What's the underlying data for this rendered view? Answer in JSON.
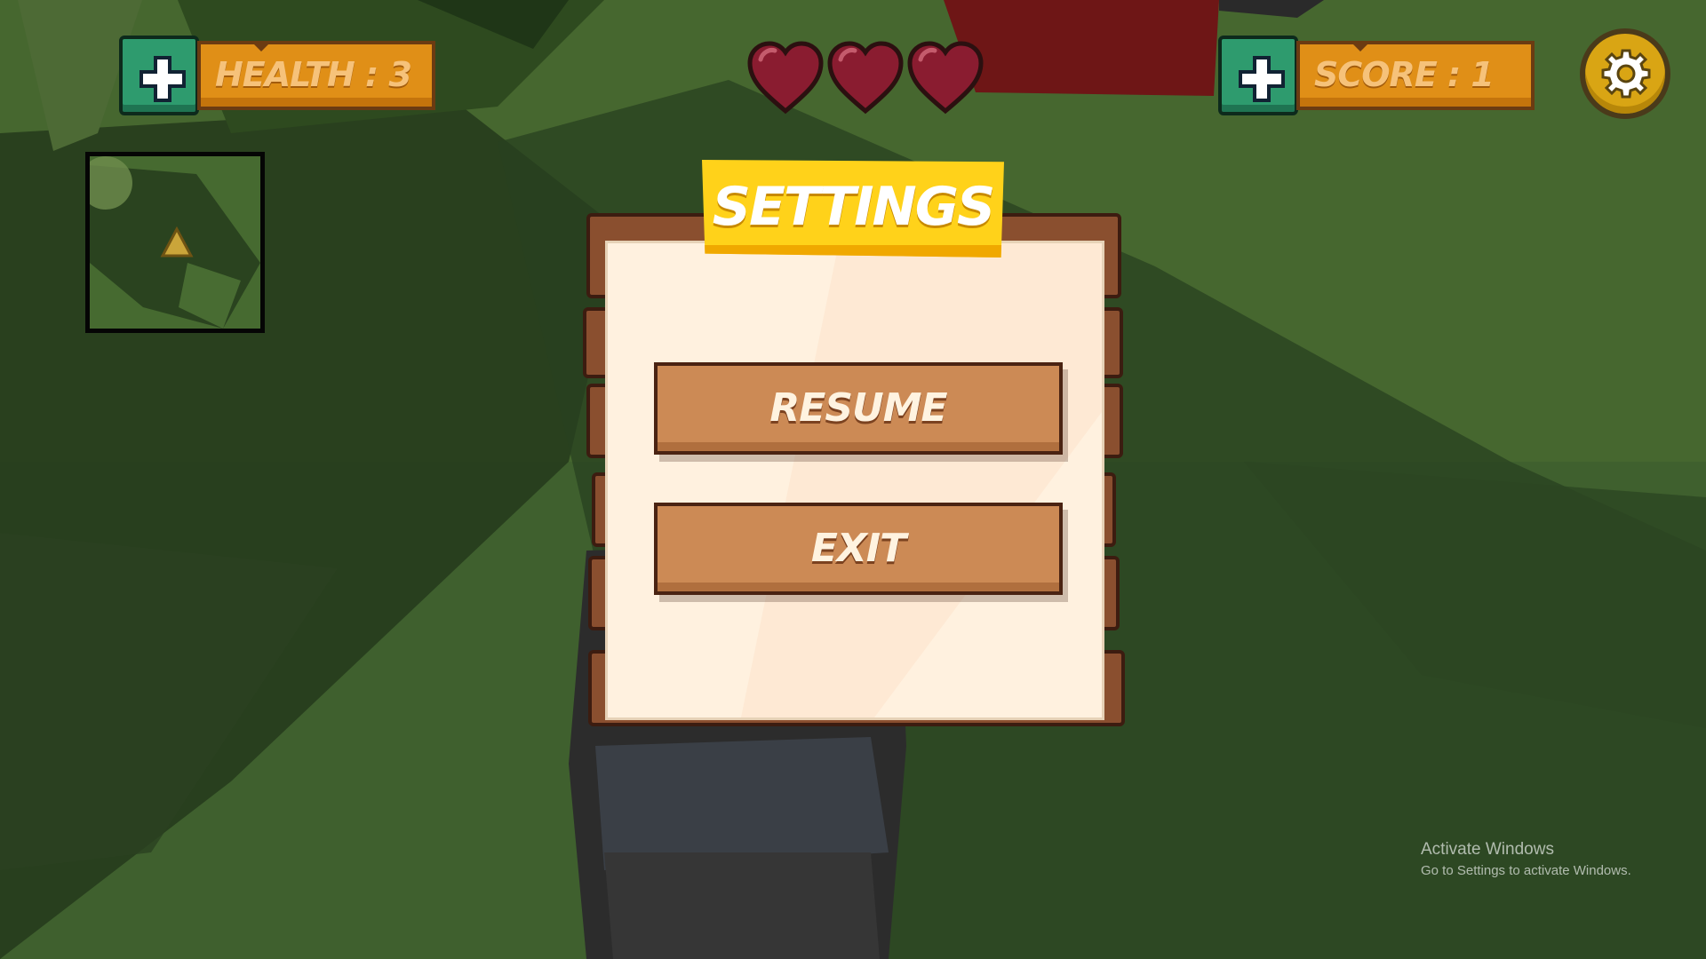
{
  "hud": {
    "health_label": "HEALTH : 3",
    "score_label": "SCORE : 1",
    "hearts": 3
  },
  "dialog": {
    "title": "SETTINGS",
    "buttons": {
      "resume": "RESUME",
      "exit": "EXIT"
    }
  },
  "watermark": {
    "title": "Activate Windows",
    "subtitle": "Go to Settings to activate Windows."
  },
  "colors": {
    "grass": "#3a5a2c",
    "hud_orange": "#e08f17",
    "hud_green": "#2e9b6e",
    "heart": "#8a1c30",
    "title_yellow": "#ffd21a",
    "plank": "#8a4f2f",
    "button_wood": "#cc8a55",
    "paper": "#fff1df"
  },
  "icons": [
    "plus-icon",
    "heart-icon",
    "gear-icon",
    "player-marker-icon"
  ]
}
